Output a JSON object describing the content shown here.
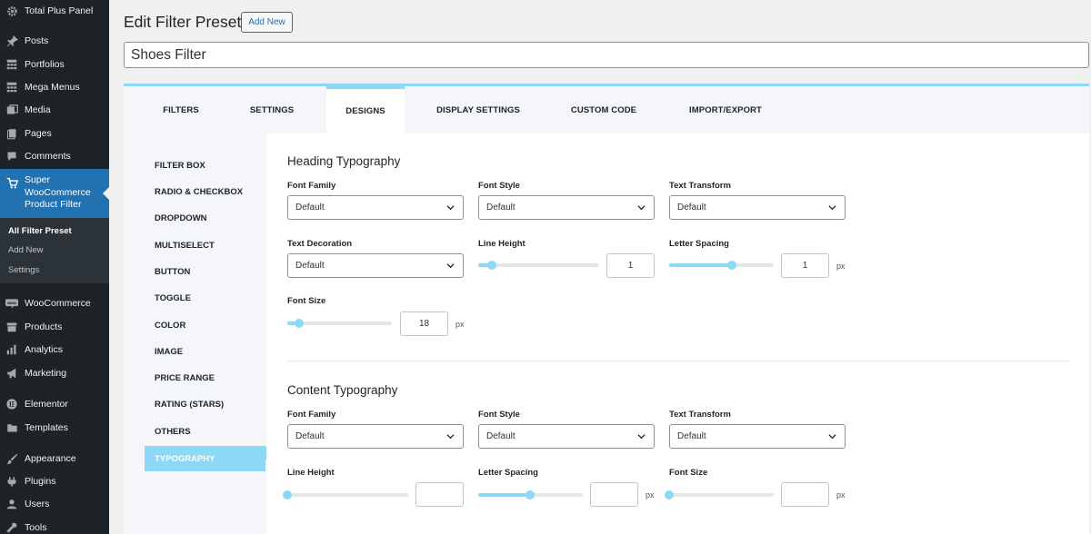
{
  "sidebar": {
    "items": [
      {
        "label": "Total Plus Panel",
        "icon": "gear-icon"
      },
      {
        "label": "Posts",
        "icon": "pin-icon"
      },
      {
        "label": "Portfolios",
        "icon": "grid-icon"
      },
      {
        "label": "Mega Menus",
        "icon": "grid-icon"
      },
      {
        "label": "Media",
        "icon": "media-icon"
      },
      {
        "label": "Pages",
        "icon": "page-icon"
      },
      {
        "label": "Comments",
        "icon": "comment-icon"
      },
      {
        "label": "Super WooCommerce Product Filter",
        "icon": "cart-icon"
      },
      {
        "label": "WooCommerce",
        "icon": "woo-icon"
      },
      {
        "label": "Products",
        "icon": "archive-icon"
      },
      {
        "label": "Analytics",
        "icon": "bar-chart-icon"
      },
      {
        "label": "Marketing",
        "icon": "megaphone-icon"
      },
      {
        "label": "Elementor",
        "icon": "elementor-icon"
      },
      {
        "label": "Templates",
        "icon": "folder-icon"
      },
      {
        "label": "Appearance",
        "icon": "brush-icon"
      },
      {
        "label": "Plugins",
        "icon": "plugin-icon"
      },
      {
        "label": "Users",
        "icon": "user-icon"
      },
      {
        "label": "Tools",
        "icon": "wrench-icon"
      }
    ],
    "submenu": [
      "All Filter Preset",
      "Add New",
      "Settings"
    ]
  },
  "header": {
    "title": "Edit Filter Preset",
    "add_new": "Add New",
    "preset_name": "Shoes Filter"
  },
  "tabs": [
    "FILTERS",
    "SETTINGS",
    "DESIGNS",
    "DISPLAY SETTINGS",
    "CUSTOM CODE",
    "IMPORT/EXPORT"
  ],
  "design_menu": [
    "FILTER BOX",
    "RADIO & CHECKBOX",
    "DROPDOWN",
    "MULTISELECT",
    "BUTTON",
    "TOGGLE",
    "COLOR",
    "IMAGE",
    "PRICE RANGE",
    "RATING (STARS)",
    "OTHERS",
    "TYPOGRAPHY"
  ],
  "heading": {
    "title": "Heading Typography",
    "font_family_label": "Font Family",
    "font_family_value": "Default",
    "font_style_label": "Font Style",
    "font_style_value": "Default",
    "text_transform_label": "Text Transform",
    "text_transform_value": "Default",
    "text_decoration_label": "Text Decoration",
    "text_decoration_value": "Default",
    "line_height_label": "Line Height",
    "line_height_value": "1",
    "letter_spacing_label": "Letter Spacing",
    "letter_spacing_value": "1",
    "letter_spacing_unit": "px",
    "font_size_label": "Font Size",
    "font_size_value": "18",
    "font_size_unit": "px"
  },
  "content_typo": {
    "title": "Content Typography",
    "font_family_label": "Font Family",
    "font_family_value": "Default",
    "font_style_label": "Font Style",
    "font_style_value": "Default",
    "text_transform_label": "Text Transform",
    "text_transform_value": "Default",
    "line_height_label": "Line Height",
    "line_height_value": "",
    "letter_spacing_label": "Letter Spacing",
    "letter_spacing_value": "",
    "letter_spacing_unit": "px",
    "font_size_label": "Font Size",
    "font_size_value": "",
    "font_size_unit": "px"
  },
  "colors": {
    "accent": "#8cd8f6",
    "admin_bar": "#1d2327",
    "admin_current": "#2271b1"
  }
}
